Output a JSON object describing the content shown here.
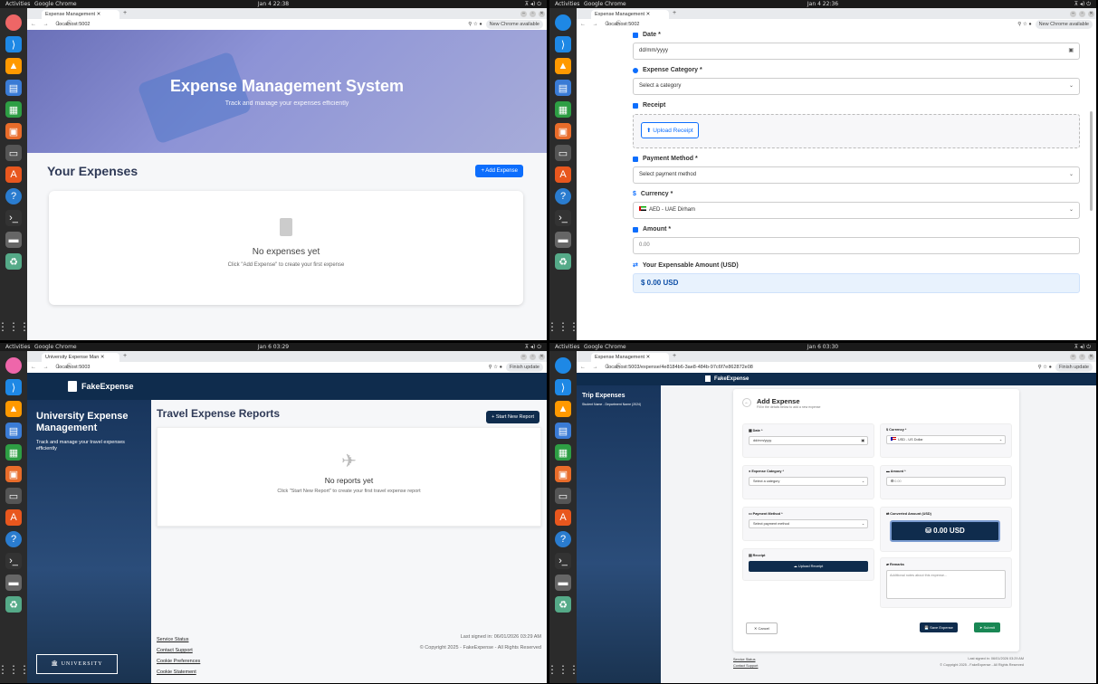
{
  "q1": {
    "topbar": {
      "activities": "Activities",
      "app": "Google Chrome",
      "clock": "Jan 4  22:38"
    },
    "tab": "Expense Management",
    "url": "localhost:5002",
    "update": "New Chrome available",
    "hero_title": "Expense Management System",
    "hero_sub": "Track and manage your expenses efficiently",
    "section": "Your Expenses",
    "add_btn": "+ Add Expense",
    "empty_title": "No expenses yet",
    "empty_sub": "Click \"Add Expense\" to create your first expense"
  },
  "q2": {
    "topbar": {
      "activities": "Activities",
      "app": "Google Chrome",
      "clock": "Jan 4  22:36"
    },
    "tab": "Expense Management",
    "url": "localhost:5002",
    "update": "New Chrome available",
    "date_label": "Date *",
    "date_value": "dd/mm/yyyy",
    "cat_label": "Expense Category *",
    "cat_value": "Select a category",
    "receipt_label": "Receipt",
    "upload_btn": "Upload Receipt",
    "pay_label": "Payment Method *",
    "pay_value": "Select payment method",
    "cur_label": "Currency *",
    "cur_value": "AED - UAE Dirham",
    "amt_label": "Amount *",
    "amt_value": "0.00",
    "usd_label": "Your Expensable Amount (USD)",
    "usd_value": "$  0.00 USD"
  },
  "q3": {
    "topbar": {
      "activities": "Activities",
      "app": "Google Chrome",
      "clock": "Jan 6  03:29"
    },
    "tab": "University Expense Man",
    "url": "localhost:5003",
    "update": "Finish update",
    "brand": "FakeExpense",
    "side_title": "University Expense Management",
    "side_sub": "Track and manage your travel expenses efficiently",
    "university": "UNIVERSITY",
    "title": "Travel Expense Reports",
    "start_btn": "+ Start New Report",
    "empty_title": "No reports yet",
    "empty_sub": "Click \"Start New Report\" to create your first travel expense report",
    "links": [
      "Service Status",
      "Contact Support",
      "Cookie Preferences",
      "Cookie Statement"
    ],
    "signed": "Last signed in: 06/01/2026 03:29 AM",
    "copyright": "© Copyright 2025 - FakeExpense - All Rights Reserved"
  },
  "q4": {
    "topbar": {
      "activities": "Activities",
      "app": "Google Chrome",
      "clock": "Jan 6  03:30"
    },
    "tab": "Expense Management",
    "url": "localhost:5003/expense/4e8184b6-3ae8-484b-97c6f7e862872e08",
    "update": "Finish update",
    "brand": "FakeExpense",
    "side_title": "Trip Expenses",
    "side_sub": "Student Name - Department Name (2024)",
    "form_title": "Add Expense",
    "form_sub": "Fill in the details below to add a new expense",
    "date_label": "Date *",
    "date_value": "dd/mm/yyyy",
    "cur_label": "Currency *",
    "cur_value": "USD - US Dollar",
    "cat_label": "Expense Category *",
    "cat_value": "Select a category",
    "amt_label": "Amount *",
    "amt_value": "0.00",
    "pay_label": "Payment Method *",
    "pay_value": "Select payment method",
    "conv_label": "Converted Amount (USD)",
    "conv_value": "0.00 USD",
    "receipt_label": "Receipt",
    "upload_btn": "Upload Receipt",
    "remarks_label": "Remarks",
    "remarks_ph": "Additional notes about this expense...",
    "cancel": "Cancel",
    "save": "Save Expense",
    "submit": "Submit",
    "links": [
      "Service Status",
      "Contact Support"
    ],
    "signed": "Last signed in: 06/01/2026 03:29 AM",
    "copyright": "© Copyright 2025 - FakeExpense - All Rights Reserved"
  }
}
